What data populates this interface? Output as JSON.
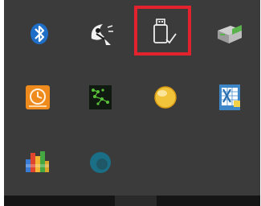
{
  "tray": {
    "highlight_color": "#e2222c",
    "icons": [
      {
        "name": "bluetooth-icon",
        "color": "#1f6fc9"
      },
      {
        "name": "satellite-dish-icon",
        "color": "#f2f2f2"
      },
      {
        "name": "usb-safely-remove-icon",
        "color": "#eeeeee",
        "highlighted": true
      },
      {
        "name": "network-printer-icon",
        "color": "#59b34a"
      },
      {
        "name": "clock-update-icon",
        "color": "#ef8a1c"
      },
      {
        "name": "terminal-network-icon",
        "color": "#59c03a"
      },
      {
        "name": "yellow-circle-icon",
        "color": "#f0c33a"
      },
      {
        "name": "spreadsheet-app-icon",
        "color": "#3d86c8"
      },
      {
        "name": "colorful-bars-icon",
        "color": "#d9a62a"
      },
      {
        "name": "teal-circle-icon",
        "color": "#1a6f86"
      }
    ]
  }
}
